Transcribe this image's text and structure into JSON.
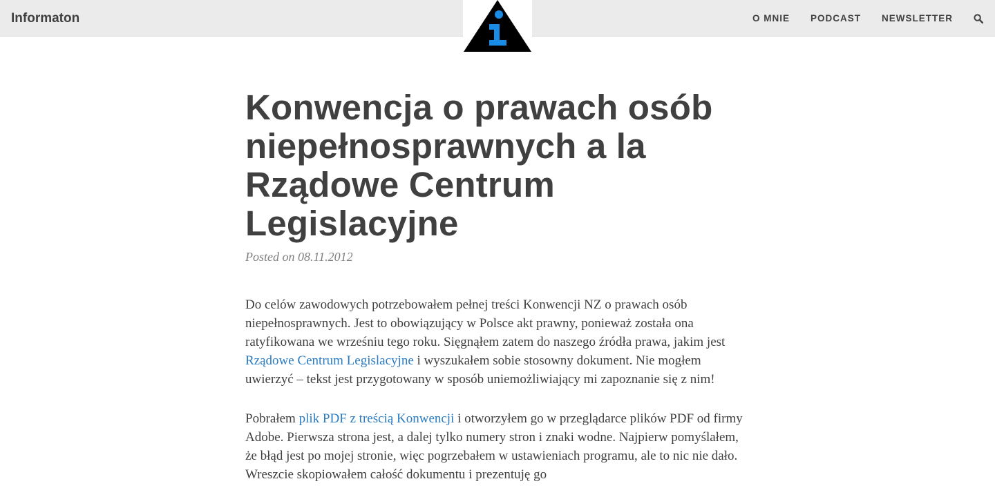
{
  "navbar": {
    "brand": "Informaton",
    "links": [
      "O MNIE",
      "PODCAST",
      "NEWSLETTER"
    ],
    "search_icon": "search-icon",
    "logo_icon": "info-triangle-icon"
  },
  "post": {
    "title": "Konwencja o prawach osób niepełnosprawnych a la Rządowe Centrum Legislacyjne",
    "meta": "Posted on 08.11.2012",
    "p1": {
      "before_link": "Do celów zawodowych potrzebowałem pełnej treści Konwencji NZ o prawach osób niepełnosprawnych. Jest to obowiązujący w Polsce akt prawny, ponieważ została ona ratyfikowana we wrześniu tego roku. Sięgnąłem zatem do naszego źródła prawa, jakim jest ",
      "link": "Rządowe Centrum Legislacyjne",
      "after_link": " i wyszukałem sobie stosowny dokument. Nie mogłem uwierzyć – tekst jest przygotowany w sposób uniemożliwiający mi zapoznanie się z nim!"
    },
    "p2": {
      "before_link": "Pobrałem ",
      "link": "plik PDF z treścią Konwencji",
      "after_link": " i otworzyłem go w przeglądarce plików PDF od firmy Adobe. Pierwsza strona jest, a dalej tylko numery stron i znaki wodne. Najpierw pomyślałem, że błąd jest po mojej stronie, więc pogrzebałem w ustawieniach programu, ale to nic nie dało. Wreszcie skopiowałem całość dokumentu i prezentuję go"
    }
  },
  "colors": {
    "navbar_bg": "#ebebeb",
    "text": "#404040",
    "meta": "#808080",
    "link": "#2b7bc0",
    "logo_blue": "#1a8ce6"
  }
}
